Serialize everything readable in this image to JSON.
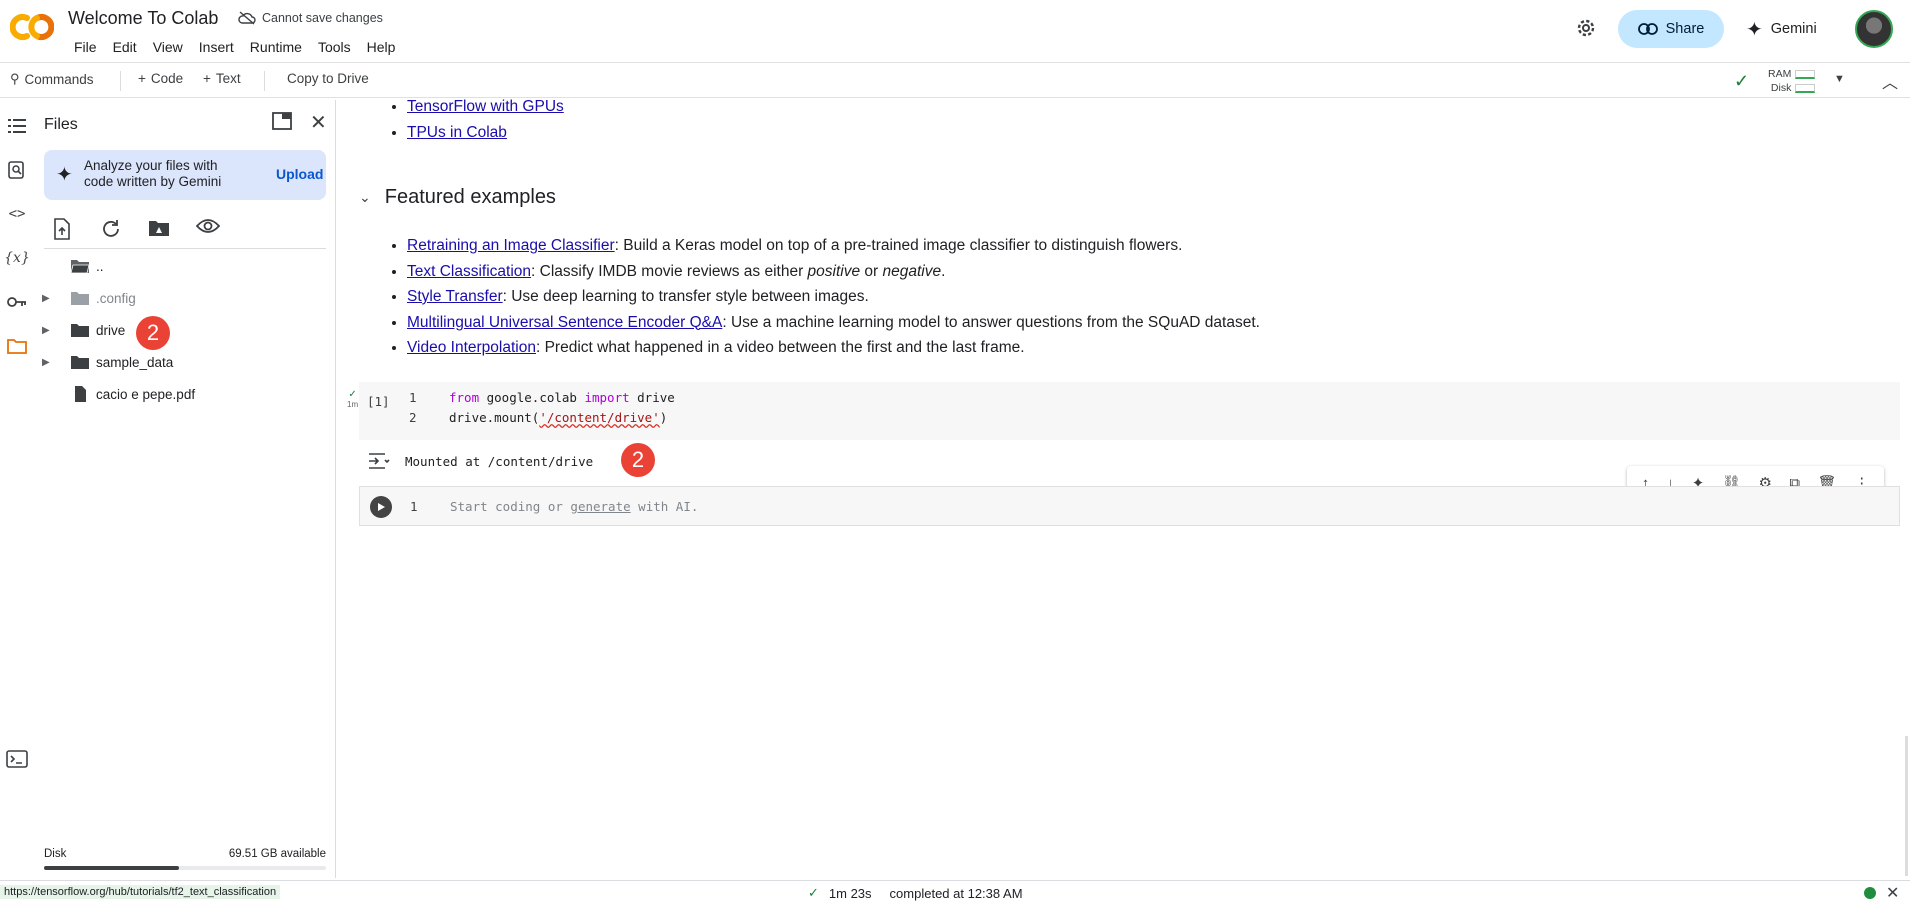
{
  "header": {
    "title": "Welcome To Colab",
    "save_status": "Cannot save changes",
    "menu": [
      "File",
      "Edit",
      "View",
      "Insert",
      "Runtime",
      "Tools",
      "Help"
    ],
    "share_label": "Share",
    "gemini_label": "Gemini"
  },
  "toolbar": {
    "commands_label": "Commands",
    "add_code_label": "Code",
    "add_text_label": "Text",
    "copy_drive_label": "Copy to Drive",
    "ram_label": "RAM",
    "disk_label": "Disk"
  },
  "files_panel": {
    "title": "Files",
    "gemini_card_text": "Analyze your files with code written by Gemini",
    "upload_label": "Upload",
    "items": [
      {
        "name": "..",
        "type": "folder-open"
      },
      {
        "name": ".config",
        "type": "folder"
      },
      {
        "name": "drive",
        "type": "folder"
      },
      {
        "name": "sample_data",
        "type": "folder"
      },
      {
        "name": "cacio e pepe.pdf",
        "type": "file"
      }
    ],
    "badge_drive": "2",
    "disk_label": "Disk",
    "disk_available": "69.51 GB available",
    "disk_usage_fraction": 0.48
  },
  "notebook": {
    "top_links": [
      "TensorFlow with GPUs",
      "TPUs in Colab"
    ],
    "featured_heading": "Featured examples",
    "featured": [
      {
        "link": "Retraining an Image Classifier",
        "text": ": Build a Keras model on top of a pre-trained image classifier to distinguish flowers."
      },
      {
        "link": "Text Classification",
        "text_a": ": Classify IMDB movie reviews as either ",
        "em_a": "positive",
        "text_b": " or ",
        "em_b": "negative",
        "text_c": "."
      },
      {
        "link": "Style Transfer",
        "text": ": Use deep learning to transfer style between images."
      },
      {
        "link": "Multilingual Universal Sentence Encoder Q&A",
        "text": ": Use a machine learning model to answer questions from the SQuAD dataset."
      },
      {
        "link": "Video Interpolation",
        "text": ": Predict what happened in a video between the first and the last frame."
      }
    ],
    "code_cell": {
      "exec_count": "[1]",
      "exec_time": "1m",
      "line1_no": "1",
      "line1_kw1": "from",
      "line1_mid": " google.colab ",
      "line1_kw2": "import",
      "line1_end": " drive",
      "line2_no": "2",
      "line2_start": "drive.mount(",
      "line2_str": "'/content/drive'",
      "line2_end": ")"
    },
    "output_text": "Mounted at /content/drive",
    "badge_output": "2",
    "empty_cell": {
      "line_no": "1",
      "placeholder_a": "Start coding or ",
      "placeholder_link": "generate",
      "placeholder_b": " with AI."
    }
  },
  "statusbar": {
    "url_hint": "https://tensorflow.org/hub/tutorials/tf2_text_classification",
    "duration": "1m 23s",
    "completed": "completed at 12:38 AM"
  }
}
